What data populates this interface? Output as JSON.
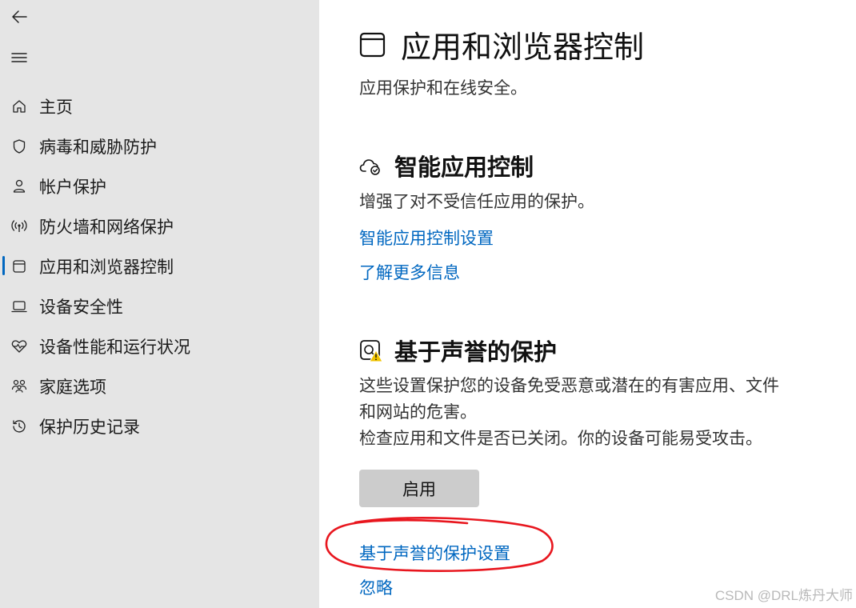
{
  "sidebar": {
    "items": [
      {
        "label": "主页",
        "icon": "home-icon"
      },
      {
        "label": "病毒和威胁防护",
        "icon": "shield-icon"
      },
      {
        "label": "帐户保护",
        "icon": "person-icon"
      },
      {
        "label": "防火墙和网络保护",
        "icon": "wireless-icon"
      },
      {
        "label": "应用和浏览器控制",
        "icon": "app-window-icon",
        "active": true
      },
      {
        "label": "设备安全性",
        "icon": "laptop-icon"
      },
      {
        "label": "设备性能和运行状况",
        "icon": "heart-pulse-icon"
      },
      {
        "label": "家庭选项",
        "icon": "family-icon"
      },
      {
        "label": "保护历史记录",
        "icon": "history-icon"
      }
    ]
  },
  "main": {
    "title": "应用和浏览器控制",
    "subtitle": "应用保护和在线安全。",
    "smart_app": {
      "title": "智能应用控制",
      "description": "增强了对不受信任应用的保护。",
      "settings_link": "智能应用控制设置",
      "learn_more_link": "了解更多信息"
    },
    "reputation": {
      "title": "基于声誉的保护",
      "description_line1": "这些设置保护您的设备免受恶意或潜在的有害应用、文件",
      "description_line2": "和网站的危害。",
      "warning": "检查应用和文件是否已关闭。你的设备可能易受攻击。",
      "enable_button": "启用",
      "settings_link": "基于声誉的保护设置",
      "dismiss_link": "忽略"
    }
  },
  "colors": {
    "sidebar_bg": "#e5e5e5",
    "accent": "#0067c0",
    "warning": "#f2c400",
    "annotation": "#e8161e"
  },
  "watermark": "CSDN @DRL炼丹大师"
}
